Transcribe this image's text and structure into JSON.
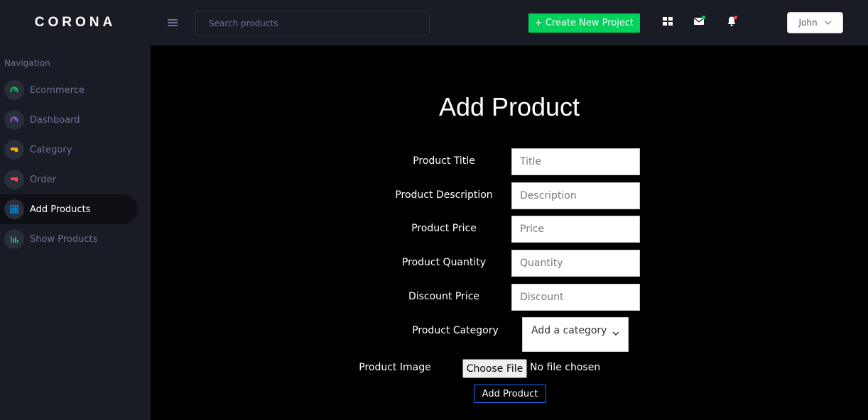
{
  "brand": "CORONA",
  "sidebar": {
    "caption": "Navigation",
    "items": [
      {
        "label": "Ecommerce",
        "icon": "gauge-icon",
        "color": "#00d25b"
      },
      {
        "label": "Dashboard",
        "icon": "gauge-icon",
        "color": "#8f5fe8"
      },
      {
        "label": "Category",
        "icon": "tag-icon",
        "color": "#ffab00"
      },
      {
        "label": "Order",
        "icon": "receipt-icon",
        "color": "#fc424a"
      },
      {
        "label": "Add Products",
        "icon": "table-icon",
        "color": "#0090e7",
        "active": true
      },
      {
        "label": "Show Products",
        "icon": "bar-chart-icon",
        "color": "#00d25b"
      }
    ]
  },
  "header": {
    "search_placeholder": "Search products",
    "create_label": "+ Create New Project",
    "user_name": "John",
    "colors": {
      "accent_green": "#00d25b",
      "notification_red": "#fc424a"
    }
  },
  "form": {
    "title": "Add Product",
    "fields": [
      {
        "label": "Product Title",
        "placeholder": "Title"
      },
      {
        "label": "Product Description",
        "placeholder": "Description"
      },
      {
        "label": "Product Price",
        "placeholder": "Price"
      },
      {
        "label": "Product Quantity",
        "placeholder": "Quantity"
      },
      {
        "label": "Discount Price",
        "placeholder": "Discount"
      }
    ],
    "category_label": "Product Category",
    "category_selected": "Add a category",
    "image_label": "Product Image",
    "file_button": "Choose File",
    "file_status": "No file chosen",
    "submit_label": "Add Product"
  }
}
